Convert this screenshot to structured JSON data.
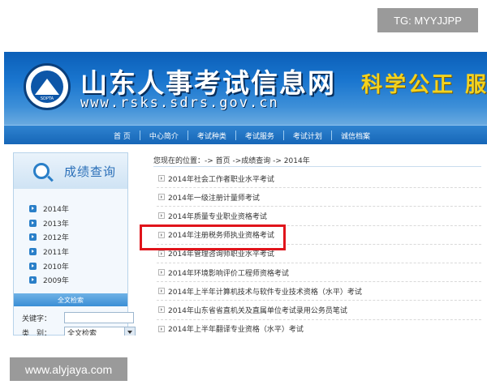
{
  "watermarks": {
    "top": "TG: MYYJJPP",
    "bottom": "www.alyjaya.com"
  },
  "header": {
    "site_title": "山东人事考试信息网",
    "url": "www.rsks.sdrs.gov.cn",
    "slogan": "科学公正 服",
    "logo_text": "SDPTA"
  },
  "nav": {
    "items": [
      "首 页",
      "中心简介",
      "考试种类",
      "考试服务",
      "考试计划",
      "诚信档案"
    ]
  },
  "sidebar": {
    "title": "成绩查询",
    "years": [
      "2014年",
      "2013年",
      "2012年",
      "2011年",
      "2010年",
      "2009年"
    ],
    "fulltext_label": "全文检索",
    "keyword_label": "关键字：",
    "keyword_value": "",
    "category_label": "类　别：",
    "category_value": "全文检索"
  },
  "breadcrumb": "您现在的位置：-> 首页 ->成绩查询 -> 2014年",
  "list": {
    "items": [
      "2014年社会工作者职业水平考试",
      "2014年一级注册计量师考试",
      "2014年质量专业职业资格考试",
      "2014年注册税务师执业资格考试",
      "2014年管理咨询师职业水平考试",
      "2014年环境影响评价工程师资格考试",
      "2014年上半年计算机技术与软件专业技术资格（水平）考试",
      "2014年山东省省直机关及直属单位考试录用公务员笔试",
      "2014年上半年翻译专业资格（水平）考试"
    ],
    "highlighted_index": 3
  },
  "colors": {
    "brand_blue": "#1a76cf",
    "highlight_red": "#e0141b",
    "slogan_yellow": "#f3d21e"
  }
}
